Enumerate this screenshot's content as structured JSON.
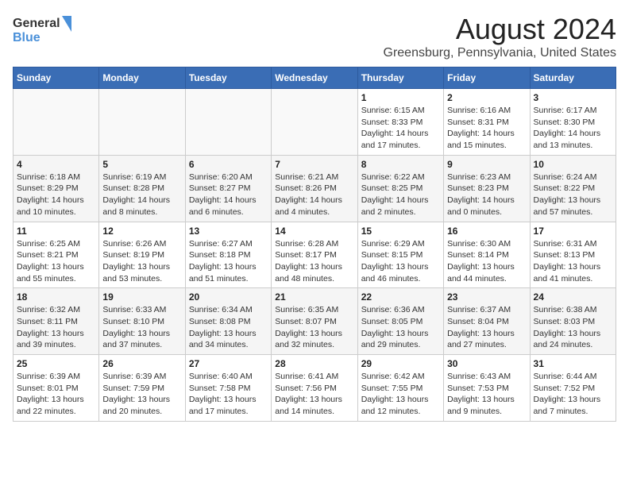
{
  "header": {
    "logo_line1": "General",
    "logo_line2": "Blue",
    "month_title": "August 2024",
    "location": "Greensburg, Pennsylvania, United States"
  },
  "days_of_week": [
    "Sunday",
    "Monday",
    "Tuesday",
    "Wednesday",
    "Thursday",
    "Friday",
    "Saturday"
  ],
  "weeks": [
    [
      {
        "day": "",
        "info": ""
      },
      {
        "day": "",
        "info": ""
      },
      {
        "day": "",
        "info": ""
      },
      {
        "day": "",
        "info": ""
      },
      {
        "day": "1",
        "info": "Sunrise: 6:15 AM\nSunset: 8:33 PM\nDaylight: 14 hours\nand 17 minutes."
      },
      {
        "day": "2",
        "info": "Sunrise: 6:16 AM\nSunset: 8:31 PM\nDaylight: 14 hours\nand 15 minutes."
      },
      {
        "day": "3",
        "info": "Sunrise: 6:17 AM\nSunset: 8:30 PM\nDaylight: 14 hours\nand 13 minutes."
      }
    ],
    [
      {
        "day": "4",
        "info": "Sunrise: 6:18 AM\nSunset: 8:29 PM\nDaylight: 14 hours\nand 10 minutes."
      },
      {
        "day": "5",
        "info": "Sunrise: 6:19 AM\nSunset: 8:28 PM\nDaylight: 14 hours\nand 8 minutes."
      },
      {
        "day": "6",
        "info": "Sunrise: 6:20 AM\nSunset: 8:27 PM\nDaylight: 14 hours\nand 6 minutes."
      },
      {
        "day": "7",
        "info": "Sunrise: 6:21 AM\nSunset: 8:26 PM\nDaylight: 14 hours\nand 4 minutes."
      },
      {
        "day": "8",
        "info": "Sunrise: 6:22 AM\nSunset: 8:25 PM\nDaylight: 14 hours\nand 2 minutes."
      },
      {
        "day": "9",
        "info": "Sunrise: 6:23 AM\nSunset: 8:23 PM\nDaylight: 14 hours\nand 0 minutes."
      },
      {
        "day": "10",
        "info": "Sunrise: 6:24 AM\nSunset: 8:22 PM\nDaylight: 13 hours\nand 57 minutes."
      }
    ],
    [
      {
        "day": "11",
        "info": "Sunrise: 6:25 AM\nSunset: 8:21 PM\nDaylight: 13 hours\nand 55 minutes."
      },
      {
        "day": "12",
        "info": "Sunrise: 6:26 AM\nSunset: 8:19 PM\nDaylight: 13 hours\nand 53 minutes."
      },
      {
        "day": "13",
        "info": "Sunrise: 6:27 AM\nSunset: 8:18 PM\nDaylight: 13 hours\nand 51 minutes."
      },
      {
        "day": "14",
        "info": "Sunrise: 6:28 AM\nSunset: 8:17 PM\nDaylight: 13 hours\nand 48 minutes."
      },
      {
        "day": "15",
        "info": "Sunrise: 6:29 AM\nSunset: 8:15 PM\nDaylight: 13 hours\nand 46 minutes."
      },
      {
        "day": "16",
        "info": "Sunrise: 6:30 AM\nSunset: 8:14 PM\nDaylight: 13 hours\nand 44 minutes."
      },
      {
        "day": "17",
        "info": "Sunrise: 6:31 AM\nSunset: 8:13 PM\nDaylight: 13 hours\nand 41 minutes."
      }
    ],
    [
      {
        "day": "18",
        "info": "Sunrise: 6:32 AM\nSunset: 8:11 PM\nDaylight: 13 hours\nand 39 minutes."
      },
      {
        "day": "19",
        "info": "Sunrise: 6:33 AM\nSunset: 8:10 PM\nDaylight: 13 hours\nand 37 minutes."
      },
      {
        "day": "20",
        "info": "Sunrise: 6:34 AM\nSunset: 8:08 PM\nDaylight: 13 hours\nand 34 minutes."
      },
      {
        "day": "21",
        "info": "Sunrise: 6:35 AM\nSunset: 8:07 PM\nDaylight: 13 hours\nand 32 minutes."
      },
      {
        "day": "22",
        "info": "Sunrise: 6:36 AM\nSunset: 8:05 PM\nDaylight: 13 hours\nand 29 minutes."
      },
      {
        "day": "23",
        "info": "Sunrise: 6:37 AM\nSunset: 8:04 PM\nDaylight: 13 hours\nand 27 minutes."
      },
      {
        "day": "24",
        "info": "Sunrise: 6:38 AM\nSunset: 8:03 PM\nDaylight: 13 hours\nand 24 minutes."
      }
    ],
    [
      {
        "day": "25",
        "info": "Sunrise: 6:39 AM\nSunset: 8:01 PM\nDaylight: 13 hours\nand 22 minutes."
      },
      {
        "day": "26",
        "info": "Sunrise: 6:39 AM\nSunset: 7:59 PM\nDaylight: 13 hours\nand 20 minutes."
      },
      {
        "day": "27",
        "info": "Sunrise: 6:40 AM\nSunset: 7:58 PM\nDaylight: 13 hours\nand 17 minutes."
      },
      {
        "day": "28",
        "info": "Sunrise: 6:41 AM\nSunset: 7:56 PM\nDaylight: 13 hours\nand 14 minutes."
      },
      {
        "day": "29",
        "info": "Sunrise: 6:42 AM\nSunset: 7:55 PM\nDaylight: 13 hours\nand 12 minutes."
      },
      {
        "day": "30",
        "info": "Sunrise: 6:43 AM\nSunset: 7:53 PM\nDaylight: 13 hours\nand 9 minutes."
      },
      {
        "day": "31",
        "info": "Sunrise: 6:44 AM\nSunset: 7:52 PM\nDaylight: 13 hours\nand 7 minutes."
      }
    ]
  ]
}
